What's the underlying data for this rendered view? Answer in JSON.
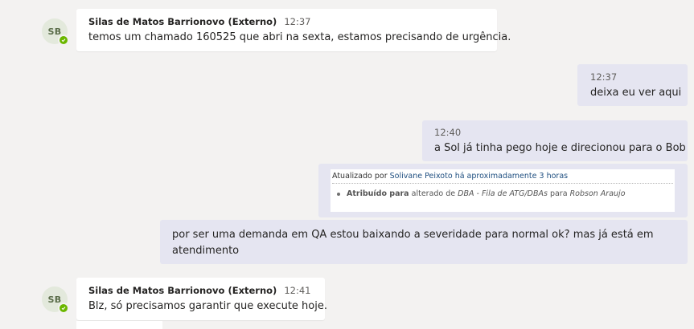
{
  "colors": {
    "background": "#f3f2f1",
    "incoming_bubble": "#ffffff",
    "outgoing_bubble": "#e5e5f1",
    "presence_available": "#6bb700",
    "link": "#205081"
  },
  "messages": [
    {
      "direction": "incoming",
      "avatar_initials": "SB",
      "sender": "Silas de Matos Barrionovo (Externo)",
      "time": "12:37",
      "text": "temos um chamado 160525 que abri na sexta, estamos precisando de urgência."
    },
    {
      "direction": "outgoing",
      "time": "12:37",
      "text": "deixa eu ver aqui"
    },
    {
      "direction": "outgoing",
      "time": "12:40",
      "text": "a Sol já tinha pego hoje e direcionou para o Bob"
    },
    {
      "direction": "outgoing",
      "card": {
        "prefix": "Atualizado por",
        "user": "Solivane Peixoto",
        "when": "há aproximadamente 3 horas",
        "item_field": "Atribuído para",
        "item_changed": "alterado de",
        "item_from": "DBA - Fila de ATG/DBAs",
        "item_to_word": "para",
        "item_to": "Robson Araujo"
      }
    },
    {
      "direction": "outgoing",
      "text_line1": "por ser uma demanda em QA estou baixando a severidade para normal ok? mas já está em",
      "text_line2": "atendimento"
    },
    {
      "direction": "incoming",
      "avatar_initials": "SB",
      "sender": "Silas de Matos Barrionovo (Externo)",
      "time": "12:41",
      "text": "Blz, só precisamos garantir que execute hoje."
    }
  ]
}
